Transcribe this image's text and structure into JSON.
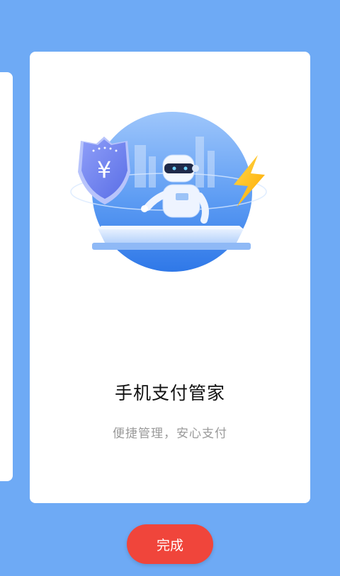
{
  "onboarding": {
    "title": "手机支付管家",
    "subtitle": "便捷管理，安心支付",
    "illustration": {
      "shield_symbol": "¥",
      "icons": [
        "shield-yen-icon",
        "robot-icon",
        "lightning-icon"
      ]
    }
  },
  "actions": {
    "done_label": "完成"
  },
  "colors": {
    "background": "#6eaaf5",
    "card": "#ffffff",
    "button": "#f0453b",
    "circle": "#5d9cf3",
    "lightning": "#ffc21a"
  }
}
